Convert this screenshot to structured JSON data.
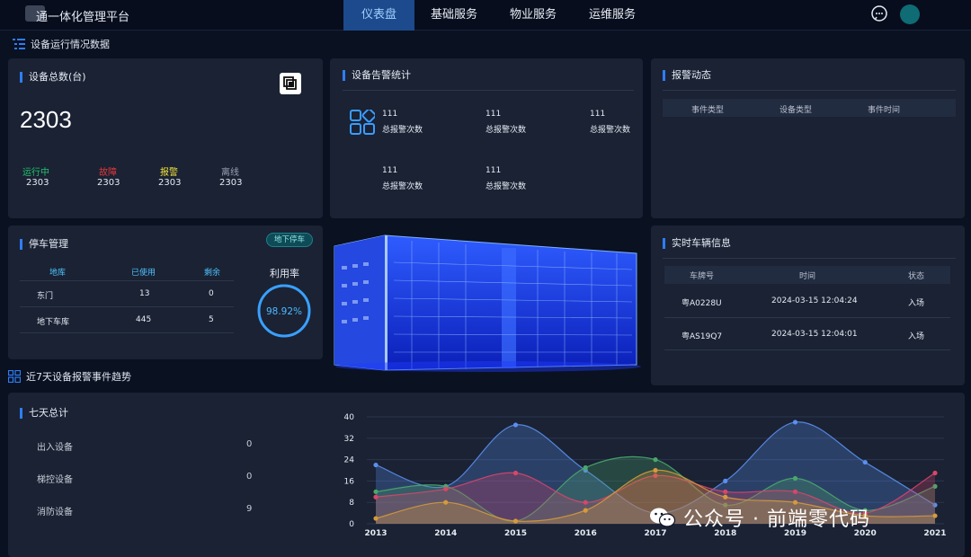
{
  "header": {
    "title": "通一体化管理平台",
    "nav": [
      "仪表盘",
      "基础服务",
      "物业服务",
      "运维服务"
    ]
  },
  "section1": {
    "title": "设备运行情况数据"
  },
  "devices": {
    "title": "设备总数(台)",
    "total": "2303",
    "stats": [
      {
        "label": "运行中",
        "value": "2303",
        "color": "#23c26b"
      },
      {
        "label": "故障",
        "value": "2303",
        "color": "#e0383b"
      },
      {
        "label": "报警",
        "value": "2303",
        "color": "#f2e13b"
      },
      {
        "label": "离线",
        "value": "2303",
        "color": "#9aa3b2"
      }
    ]
  },
  "alarm_stats": {
    "title": "设备告警统计",
    "items": [
      {
        "count": "111",
        "label": "总报警次数"
      },
      {
        "count": "111",
        "label": "总报警次数"
      },
      {
        "count": "111",
        "label": "总报警次数"
      },
      {
        "count": "111",
        "label": "总报警次数"
      },
      {
        "count": "111",
        "label": "总报警次数"
      }
    ]
  },
  "alarm_feed": {
    "title": "报警动态",
    "columns": [
      "事件类型",
      "设备类型",
      "事件时间"
    ]
  },
  "parking": {
    "title": "停车管理",
    "badge": "地下停车",
    "columns": [
      "地库",
      "已使用",
      "剩余"
    ],
    "rows": [
      [
        "东门",
        "13",
        "0"
      ],
      [
        "地下车库",
        "445",
        "5"
      ]
    ],
    "util_label": "利用率",
    "util_value": "98.92%",
    "util_fraction": 0.9892
  },
  "vehicles": {
    "title": "实时车辆信息",
    "columns": [
      "车牌号",
      "时间",
      "状态"
    ],
    "rows": [
      [
        "粤A0228U",
        "2024-03-15 12:04:24",
        "入场"
      ],
      [
        "粤AS19Q7",
        "2024-03-15 12:04:01",
        "入场"
      ]
    ]
  },
  "section2": {
    "title": "近7天设备报警事件趋势"
  },
  "weekly": {
    "title": "七天总计",
    "items": [
      {
        "label": "出入设备",
        "value": "0"
      },
      {
        "label": "梯控设备",
        "value": "0"
      },
      {
        "label": "消防设备",
        "value": "9"
      }
    ]
  },
  "chart_data": {
    "type": "area",
    "categories": [
      "2013",
      "2014",
      "2015",
      "2016",
      "2017",
      "2018",
      "2019",
      "2020",
      "2021"
    ],
    "ylim": [
      0,
      40
    ],
    "yticks": [
      "0",
      "8",
      "16",
      "24",
      "32",
      "40"
    ],
    "grid": true,
    "series": [
      {
        "color": "#5b8ff0",
        "values": [
          22,
          14,
          37,
          20,
          4,
          16,
          38,
          23,
          7
        ]
      },
      {
        "color": "#4aa86a",
        "values": [
          12,
          14,
          1,
          21,
          24,
          7,
          17,
          5,
          14
        ]
      },
      {
        "color": "#d9466a",
        "values": [
          10,
          13,
          19,
          8,
          18,
          12,
          12,
          4,
          19
        ]
      },
      {
        "color": "#d49a3c",
        "values": [
          2,
          8,
          1,
          5,
          20,
          10,
          8,
          3,
          3
        ]
      }
    ]
  },
  "watermark": {
    "text": "公众号 · 前端零代码"
  }
}
